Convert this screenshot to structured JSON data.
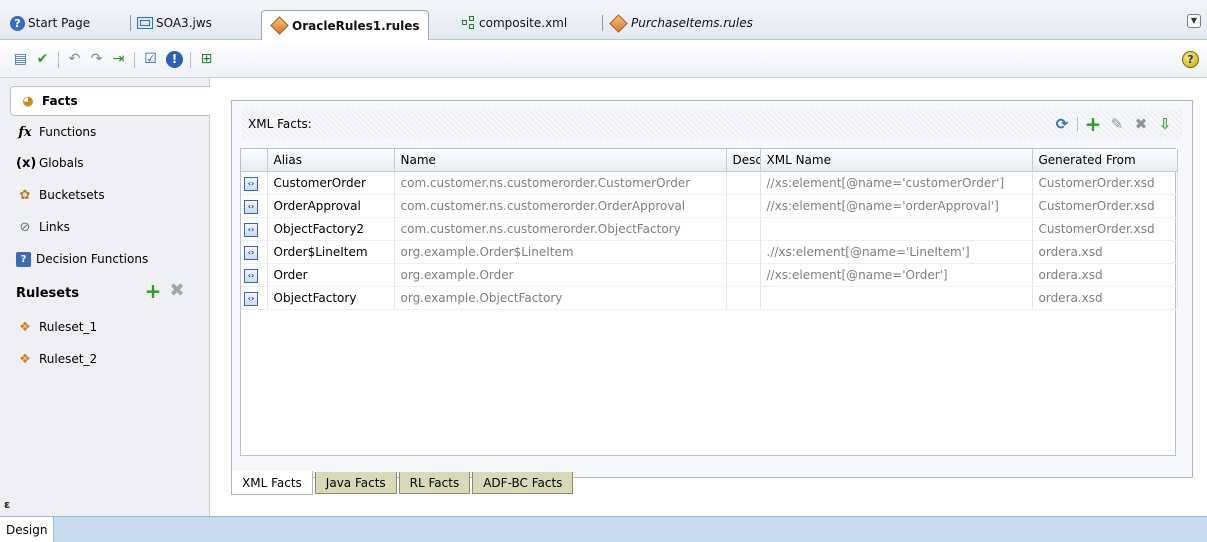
{
  "tabs": [
    {
      "label": "Start Page",
      "icon": "help-circle-icon"
    },
    {
      "label": "SOA3.jws",
      "icon": "workspace-icon"
    },
    {
      "label": "OracleRules1.rules",
      "icon": "rules-diamond-icon",
      "active": true
    },
    {
      "label": "composite.xml",
      "icon": "composite-icon"
    },
    {
      "label": "PurchaseItems.rules",
      "icon": "rules-diamond-icon"
    }
  ],
  "toolbar": {
    "icons": [
      "book-icon",
      "check-icon",
      "undo-icon",
      "redo-icon",
      "export-icon",
      "validate-icon",
      "alert-icon",
      "tree-icon"
    ],
    "help_label": "?"
  },
  "nav": {
    "facts": "Facts",
    "functions": "Functions",
    "globals": "Globals",
    "bucketsets": "Bucketsets",
    "links": "Links",
    "decision_functions": "Decision Functions",
    "rulesets_title": "Rulesets",
    "rulesets": [
      "Ruleset_1",
      "Ruleset_2"
    ],
    "collapse_glyph": "ε"
  },
  "facts_panel": {
    "title": "XML Facts:",
    "columns": [
      "Alias",
      "Name",
      "Desc",
      "XML Name",
      "Generated From"
    ],
    "rows": [
      {
        "alias": "CustomerOrder",
        "name": "com.customer.ns.customerorder.CustomerOrder",
        "desc": "",
        "xml_name": "//xs:element[@name='customerOrder']",
        "generated_from": "CustomerOrder.xsd"
      },
      {
        "alias": "OrderApproval",
        "name": "com.customer.ns.customerorder.OrderApproval",
        "desc": "",
        "xml_name": "//xs:element[@name='orderApproval']",
        "generated_from": "CustomerOrder.xsd"
      },
      {
        "alias": "ObjectFactory2",
        "name": "com.customer.ns.customerorder.ObjectFactory",
        "desc": "",
        "xml_name": "",
        "generated_from": "CustomerOrder.xsd"
      },
      {
        "alias": "Order$LineItem",
        "name": "org.example.Order$LineItem",
        "desc": "",
        "xml_name": ".//xs:element[@name='LineItem']",
        "generated_from": "ordera.xsd"
      },
      {
        "alias": "Order",
        "name": "org.example.Order",
        "desc": "",
        "xml_name": "//xs:element[@name='Order']",
        "generated_from": "ordera.xsd"
      },
      {
        "alias": "ObjectFactory",
        "name": "org.example.ObjectFactory",
        "desc": "",
        "xml_name": "",
        "generated_from": "ordera.xsd"
      }
    ]
  },
  "bottom_tabs": [
    "XML Facts",
    "Java Facts",
    "RL Facts",
    "ADF-BC Facts"
  ],
  "status": {
    "design_tab": "Design"
  }
}
